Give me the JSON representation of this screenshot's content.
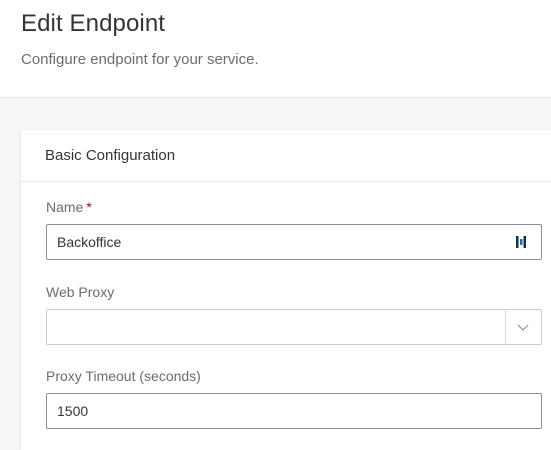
{
  "header": {
    "title": "Edit Endpoint",
    "subtitle": "Configure endpoint for your service."
  },
  "card": {
    "title": "Basic Configuration"
  },
  "fields": {
    "name": {
      "label": "Name",
      "required_mark": "*",
      "value": "Backoffice",
      "icon": "password-manager-icon"
    },
    "web_proxy": {
      "label": "Web Proxy",
      "value": "",
      "icon": "chevron-down-icon"
    },
    "proxy_timeout": {
      "label": "Proxy Timeout (seconds)",
      "value": "1500"
    }
  },
  "colors": {
    "required": "#bb0000",
    "input_border": "#89919a",
    "disabled_border": "#c9ccd0",
    "icon_blue": "#0a6ed1"
  }
}
